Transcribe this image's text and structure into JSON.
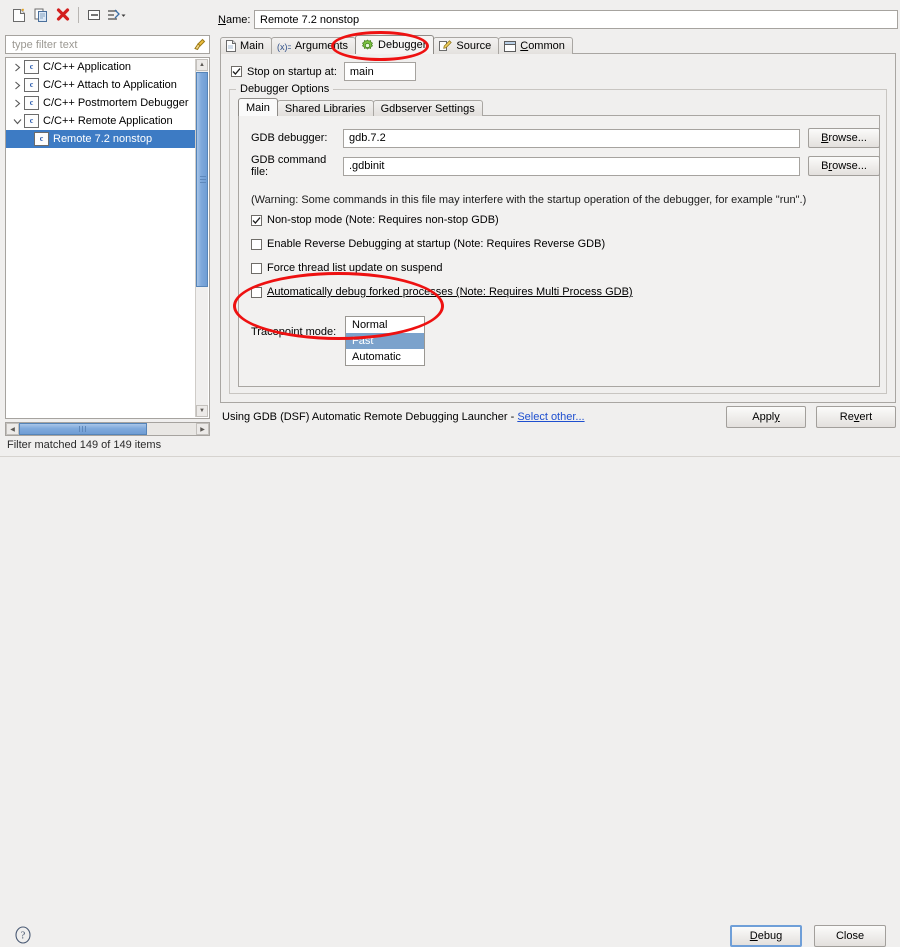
{
  "left": {
    "toolbar": [
      {
        "name": "new-configuration-icon",
        "label": "New launch configuration"
      },
      {
        "name": "duplicate-configuration-icon",
        "label": "Duplicate launch configuration"
      },
      {
        "name": "delete-configuration-icon",
        "label": "Delete launch configuration"
      },
      {
        "name": "collapse-all-icon",
        "label": "Collapse All"
      },
      {
        "name": "filter-menu-icon",
        "label": "Filter launch configurations"
      }
    ],
    "filter": {
      "placeholder": "type filter text",
      "clear_icon": "broom-icon"
    },
    "tree": [
      {
        "label": "C/C++ Application",
        "expanded": false,
        "selected": false,
        "depth": 0
      },
      {
        "label": "C/C++ Attach to Application",
        "expanded": false,
        "selected": false,
        "depth": 0
      },
      {
        "label": "C/C++ Postmortem Debugger",
        "expanded": false,
        "selected": false,
        "depth": 0
      },
      {
        "label": "C/C++ Remote Application",
        "expanded": true,
        "selected": false,
        "depth": 0
      },
      {
        "label": "Remote 7.2 nonstop",
        "expanded": null,
        "selected": true,
        "depth": 1
      }
    ],
    "status": "Filter matched 149 of 149 items"
  },
  "right": {
    "name_label": "Name:",
    "name_mnemonic": "N",
    "name_value": "Remote 7.2 nonstop",
    "tabs": [
      {
        "label": "Main",
        "icon": "document-icon",
        "active": false
      },
      {
        "label": "Arguments",
        "icon": "variable-icon",
        "active": false
      },
      {
        "label": "Debugger",
        "icon": "bug-gear-icon",
        "active": true,
        "highlighted": true
      },
      {
        "label": "Source",
        "icon": "pencil-icon",
        "active": false
      },
      {
        "label": "Common",
        "icon": "window-icon",
        "active": false,
        "mnemonic": "C"
      }
    ],
    "stop_on_startup": {
      "label": "Stop on startup at:",
      "checked": true,
      "value": "main"
    },
    "group_title": "Debugger Options",
    "inner_tabs": [
      {
        "label": "Main",
        "active": true
      },
      {
        "label": "Shared Libraries",
        "active": false
      },
      {
        "label": "Gdbserver Settings",
        "active": false
      }
    ],
    "fields": [
      {
        "label": "GDB debugger:",
        "value": "gdb.7.2",
        "button": "Browse...",
        "button_mnemonic": "B"
      },
      {
        "label": "GDB command file:",
        "value": ".gdbinit",
        "button": "Browse...",
        "button_mnemonic": "r"
      }
    ],
    "warning": "(Warning: Some commands in this file may interfere with the startup operation of the debugger, for example \"run\".)",
    "checkboxes": [
      {
        "label": "Non-stop mode (Note: Requires non-stop GDB)",
        "checked": true,
        "underlined": false
      },
      {
        "label": "Enable Reverse Debugging at startup (Note: Requires Reverse GDB)",
        "checked": false,
        "underlined": false
      },
      {
        "label": "Force thread list update on suspend",
        "checked": false,
        "underlined": false
      },
      {
        "label": "Automatically debug forked processes (Note: Requires Multi Process GDB)",
        "checked": false,
        "underlined": true
      }
    ],
    "tracepoint": {
      "label": "Tracepoint mode:",
      "options": [
        "Normal",
        "Fast",
        "Automatic"
      ],
      "selected": "Fast",
      "open": true
    },
    "launcher_text": "Using GDB (DSF) Automatic Remote Debugging Launcher - ",
    "launcher_link": "Select other...",
    "apply_label": "Apply",
    "apply_mnemonic": "y",
    "revert_label": "Revert",
    "revert_mnemonic": "v"
  },
  "footer": {
    "help_icon": "help-question-icon",
    "debug_label": "Debug",
    "debug_mnemonic": "D",
    "close_label": "Close"
  },
  "colors": {
    "selection_blue": "#3d7bc4",
    "dropdown_highlight": "#7ba2cc",
    "annotation_red": "#ee1111",
    "link_blue": "#1e4fcf",
    "window_bg": "#f0efee"
  }
}
